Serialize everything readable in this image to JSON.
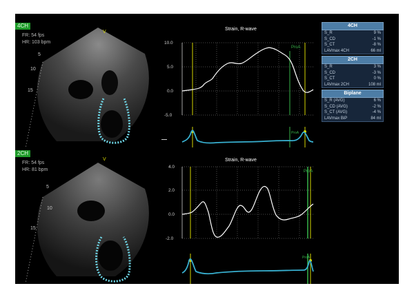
{
  "views": [
    {
      "tag": "4CH",
      "fr": "FR: 54 fps",
      "hr": "HR: 103 bpm",
      "v_marker": "V",
      "depths": [
        "5",
        "10",
        "15"
      ],
      "graph": {
        "title": "Strain, R-wave",
        "y_ticks": [
          "10.0",
          "5.0",
          "0.0",
          "-5.0"
        ],
        "marker_label": "ProA",
        "ecg_marker_label": "ProA"
      }
    },
    {
      "tag": "2CH",
      "fr": "FR: 54 fps",
      "hr": "HR: 81 bpm",
      "v_marker": "V",
      "depths": [
        "5",
        "10",
        "15"
      ],
      "graph": {
        "title": "Strain, R-wave",
        "y_ticks": [
          "4.0",
          "2.0",
          "0.0",
          "-2.0"
        ],
        "marker_label": "ProA",
        "ecg_marker_label": "ProA"
      }
    }
  ],
  "results": [
    {
      "header": "4CH",
      "rows": [
        {
          "label": "S_R",
          "value": "9 %"
        },
        {
          "label": "S_CD",
          "value": "-1 %"
        },
        {
          "label": "S_CT",
          "value": "-8 %"
        },
        {
          "label": "LAVmax 4CH",
          "value": "66 ml"
        }
      ]
    },
    {
      "header": "2CH",
      "rows": [
        {
          "label": "S_R",
          "value": "3 %"
        },
        {
          "label": "S_CD",
          "value": "-3 %"
        },
        {
          "label": "S_CT",
          "value": "0 %"
        },
        {
          "label": "LAVmax 2CH",
          "value": "108 ml"
        }
      ]
    },
    {
      "header": "Biplane",
      "rows": [
        {
          "label": "S_R (AVG)",
          "value": "6 %"
        },
        {
          "label": "S_CD (AVG)",
          "value": "-2 %"
        },
        {
          "label": "S_CT (AVG)",
          "value": "-4 %"
        },
        {
          "label": "LAVmax BiP",
          "value": "84 ml"
        }
      ]
    }
  ],
  "colors": {
    "background": "#000000",
    "grid": "#9a9a9a",
    "strain_curve": "#ffffff",
    "event_marker": "#d6d600",
    "prea_marker": "#39b54a",
    "ecg": "#38b0d0",
    "tracking": "#6fd6e6",
    "panel_header": "#4d7da6",
    "panel_row": "#17263a"
  }
}
